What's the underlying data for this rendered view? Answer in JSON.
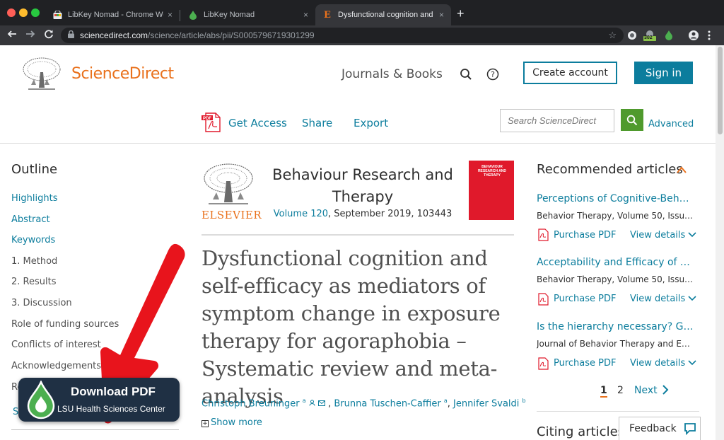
{
  "browser": {
    "tabs": [
      {
        "title": "LibKey Nomad - Chrome Web S",
        "close": "×"
      },
      {
        "title": "LibKey Nomad",
        "close": "×"
      },
      {
        "title": "Dysfunctional cognition and sel",
        "close": "×"
      }
    ],
    "new_tab": "+",
    "url_host": "sciencedirect.com",
    "url_path": "/science/article/abs/pii/S0005796719301299",
    "extension_badge": "302",
    "colors": {
      "chrome_dark": "#202124",
      "chrome_mid": "#35363a"
    }
  },
  "header": {
    "brand": "ScienceDirect",
    "journals_books": "Journals & Books",
    "create_account": "Create account",
    "sign_in": "Sign in",
    "colors": {
      "brand": "#e9711c",
      "accent": "#0c7d9d"
    }
  },
  "toolbar": {
    "get_access": "Get Access",
    "share": "Share",
    "export": "Export",
    "search_placeholder": "Search ScienceDirect",
    "advanced": "Advanced"
  },
  "outline": {
    "title": "Outline",
    "items": [
      {
        "label": "Highlights"
      },
      {
        "label": "Abstract"
      },
      {
        "label": "Keywords"
      },
      {
        "label": "1. Method"
      },
      {
        "label": "2. Results"
      },
      {
        "label": "3. Discussion"
      },
      {
        "label": "Role of funding sources"
      },
      {
        "label": "Conflicts of interest"
      },
      {
        "label": "Acknowledgements"
      }
    ],
    "partial_1": "Re",
    "partial_2": "S"
  },
  "article": {
    "publisher": "ELSEVIER",
    "journal": "Behaviour Research and Therapy",
    "volume_link": "Volume 120",
    "volume_rest": ", September 2019, 103443",
    "cover_text": "BEHAVIOUR RESEARCH AND THERAPY",
    "title": "Dysfunctional cognition and self-efficacy as mediators of symptom change in exposure therapy for agoraphobia – Systematic review and meta-analysis",
    "authors": [
      {
        "name": "Christoph Breuninger",
        "sup": "a"
      },
      {
        "name": "Brunna Tuschen-Caffier",
        "sup": "a"
      },
      {
        "name": "Jennifer Svaldi",
        "sup": "b"
      }
    ],
    "show_more": "Show more"
  },
  "recommended": {
    "title": "Recommended articles",
    "items": [
      {
        "title": "Perceptions of Cognitive-Behav...",
        "source": "Behavior Therapy, Volume 50, Issue ...",
        "purchase": "Purchase PDF",
        "view": "View details"
      },
      {
        "title": "Acceptability and Efficacy of Gr...",
        "source": "Behavior Therapy, Volume 50, Issue ...",
        "purchase": "Purchase PDF",
        "view": "View details"
      },
      {
        "title": "Is the hierarchy necessary? Gra...",
        "source": "Journal of Behavior Therapy and Ex...",
        "purchase": "Purchase PDF",
        "view": "View details"
      }
    ],
    "pages": [
      "1",
      "2"
    ],
    "next": "Next",
    "citing": "Citing articles",
    "feedback": "Feedback"
  },
  "overlay": {
    "download_pdf": "Download PDF",
    "institution": "LSU Health Sciences Center",
    "arrow_color": "#e8141c"
  }
}
